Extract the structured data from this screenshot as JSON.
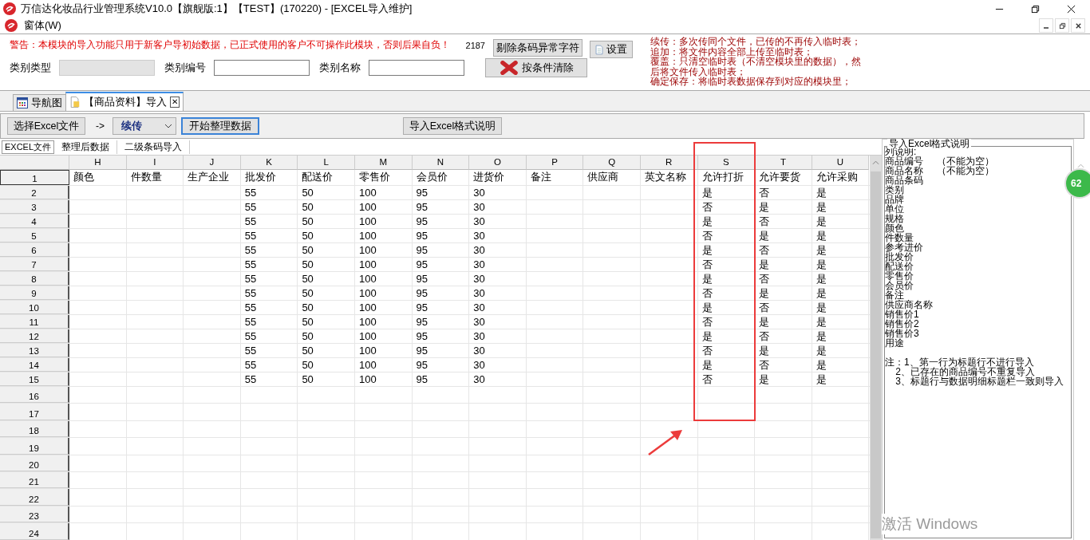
{
  "window": {
    "title": "万信达化妆品行业管理系统V10.0【旗舰版:1】【TEST】(170220) - [EXCEL导入维护]"
  },
  "menu": {
    "label": "窗体(W)"
  },
  "top_panel": {
    "warning": "警告：本模块的导入功能只用于新客户导初始数据，已正式使用的客户不可操作此模块，否则后果自负！",
    "count": "2187",
    "buttons": [
      {
        "label": "剔除条码异常字符",
        "kind": "plain"
      },
      {
        "label": "按条件清除",
        "kind": "clear"
      },
      {
        "label": "设置",
        "kind": "doc"
      }
    ],
    "fields": [
      {
        "label": "类别类型",
        "disabled": true
      },
      {
        "label": "类别编号",
        "disabled": false
      },
      {
        "label": "类别名称",
        "disabled": false
      }
    ],
    "notes": [
      "续传：多次传同个文件，已传的不再传入临时表；",
      "追加：将文件内容全部上传至临时表；",
      "覆盖：只清空临时表（不清空模块里的数据），然",
      "后将文件传入临时表；",
      "确定保存：将临时表数据保存到对应的模块里；"
    ]
  },
  "tabs": [
    {
      "label": "导航图",
      "kind": "grid",
      "selected": false
    },
    {
      "label": "【商品资料】导入",
      "kind": "doc",
      "selected": true,
      "close": "✕"
    }
  ],
  "toolbar": {
    "choose_button": "选择Excel文件",
    "arrow": "->",
    "mode": "续传",
    "start_button": "开始整理数据",
    "help_button": "导入Excel格式说明"
  },
  "sub_tabs": [
    {
      "label": "EXCEL文件",
      "selected": true
    },
    {
      "label": "整理后数据",
      "selected": false
    },
    {
      "label": "二级条码导入",
      "selected": false
    }
  ],
  "table": {
    "columns": [
      "H",
      "I",
      "J",
      "K",
      "L",
      "M",
      "N",
      "O",
      "P",
      "Q",
      "R",
      "S",
      "T",
      "U"
    ],
    "rows": [
      {
        "number": "1",
        "cells": [
          "颜色",
          "件数量",
          "生产企业",
          "批发价",
          "配送价",
          "零售价",
          "会员价",
          "进货价",
          "备注",
          "供应商",
          "英文名称",
          "允许打折",
          "允许要货",
          "允许采购"
        ]
      },
      {
        "number": "2",
        "cells": [
          "",
          "",
          "",
          "55",
          "50",
          "100",
          "95",
          "30",
          "",
          "",
          "",
          "是",
          "否",
          "是"
        ]
      },
      {
        "number": "3",
        "cells": [
          "",
          "",
          "",
          "55",
          "50",
          "100",
          "95",
          "30",
          "",
          "",
          "",
          "否",
          "是",
          "是"
        ]
      },
      {
        "number": "4",
        "cells": [
          "",
          "",
          "",
          "55",
          "50",
          "100",
          "95",
          "30",
          "",
          "",
          "",
          "是",
          "否",
          "是"
        ]
      },
      {
        "number": "5",
        "cells": [
          "",
          "",
          "",
          "55",
          "50",
          "100",
          "95",
          "30",
          "",
          "",
          "",
          "否",
          "是",
          "是"
        ]
      },
      {
        "number": "6",
        "cells": [
          "",
          "",
          "",
          "55",
          "50",
          "100",
          "95",
          "30",
          "",
          "",
          "",
          "是",
          "否",
          "是"
        ]
      },
      {
        "number": "7",
        "cells": [
          "",
          "",
          "",
          "55",
          "50",
          "100",
          "95",
          "30",
          "",
          "",
          "",
          "否",
          "是",
          "是"
        ]
      },
      {
        "number": "8",
        "cells": [
          "",
          "",
          "",
          "55",
          "50",
          "100",
          "95",
          "30",
          "",
          "",
          "",
          "是",
          "否",
          "是"
        ]
      },
      {
        "number": "9",
        "cells": [
          "",
          "",
          "",
          "55",
          "50",
          "100",
          "95",
          "30",
          "",
          "",
          "",
          "否",
          "是",
          "是"
        ]
      },
      {
        "number": "10",
        "cells": [
          "",
          "",
          "",
          "55",
          "50",
          "100",
          "95",
          "30",
          "",
          "",
          "",
          "是",
          "否",
          "是"
        ]
      },
      {
        "number": "11",
        "cells": [
          "",
          "",
          "",
          "55",
          "50",
          "100",
          "95",
          "30",
          "",
          "",
          "",
          "否",
          "是",
          "是"
        ]
      },
      {
        "number": "12",
        "cells": [
          "",
          "",
          "",
          "55",
          "50",
          "100",
          "95",
          "30",
          "",
          "",
          "",
          "是",
          "否",
          "是"
        ]
      },
      {
        "number": "13",
        "cells": [
          "",
          "",
          "",
          "55",
          "50",
          "100",
          "95",
          "30",
          "",
          "",
          "",
          "否",
          "是",
          "是"
        ]
      },
      {
        "number": "14",
        "cells": [
          "",
          "",
          "",
          "55",
          "50",
          "100",
          "95",
          "30",
          "",
          "",
          "",
          "是",
          "否",
          "是"
        ]
      },
      {
        "number": "15",
        "cells": [
          "",
          "",
          "",
          "55",
          "50",
          "100",
          "95",
          "30",
          "",
          "",
          "",
          "否",
          "是",
          "是"
        ]
      },
      {
        "number": "16"
      },
      {
        "number": "17"
      },
      {
        "number": "18"
      },
      {
        "number": "19"
      },
      {
        "number": "20"
      },
      {
        "number": "21"
      },
      {
        "number": "22"
      },
      {
        "number": "23"
      },
      {
        "number": "24"
      }
    ]
  },
  "format_panel": {
    "title": "导入Excel格式说明",
    "lines": [
      "列说明:",
      "商品编号     （不能为空）",
      "商品名称     （不能为空）",
      "商品条码",
      "类别",
      "品牌",
      "单位",
      "规格",
      "颜色",
      "件数量",
      "参考进价",
      "批发价",
      "配送价",
      "零售价",
      "会员价",
      "备注",
      "供应商名称",
      "销售价1",
      "销售价2",
      "销售价3",
      "用途"
    ],
    "notes": [
      "注：1、第一行为标题行不进行导入",
      "    2、已存在的商品编号不重复导入",
      "    3、标题行与数据明细标题栏一致则导入"
    ]
  },
  "floating_badge": "62",
  "activation_text": "激活 Windows"
}
